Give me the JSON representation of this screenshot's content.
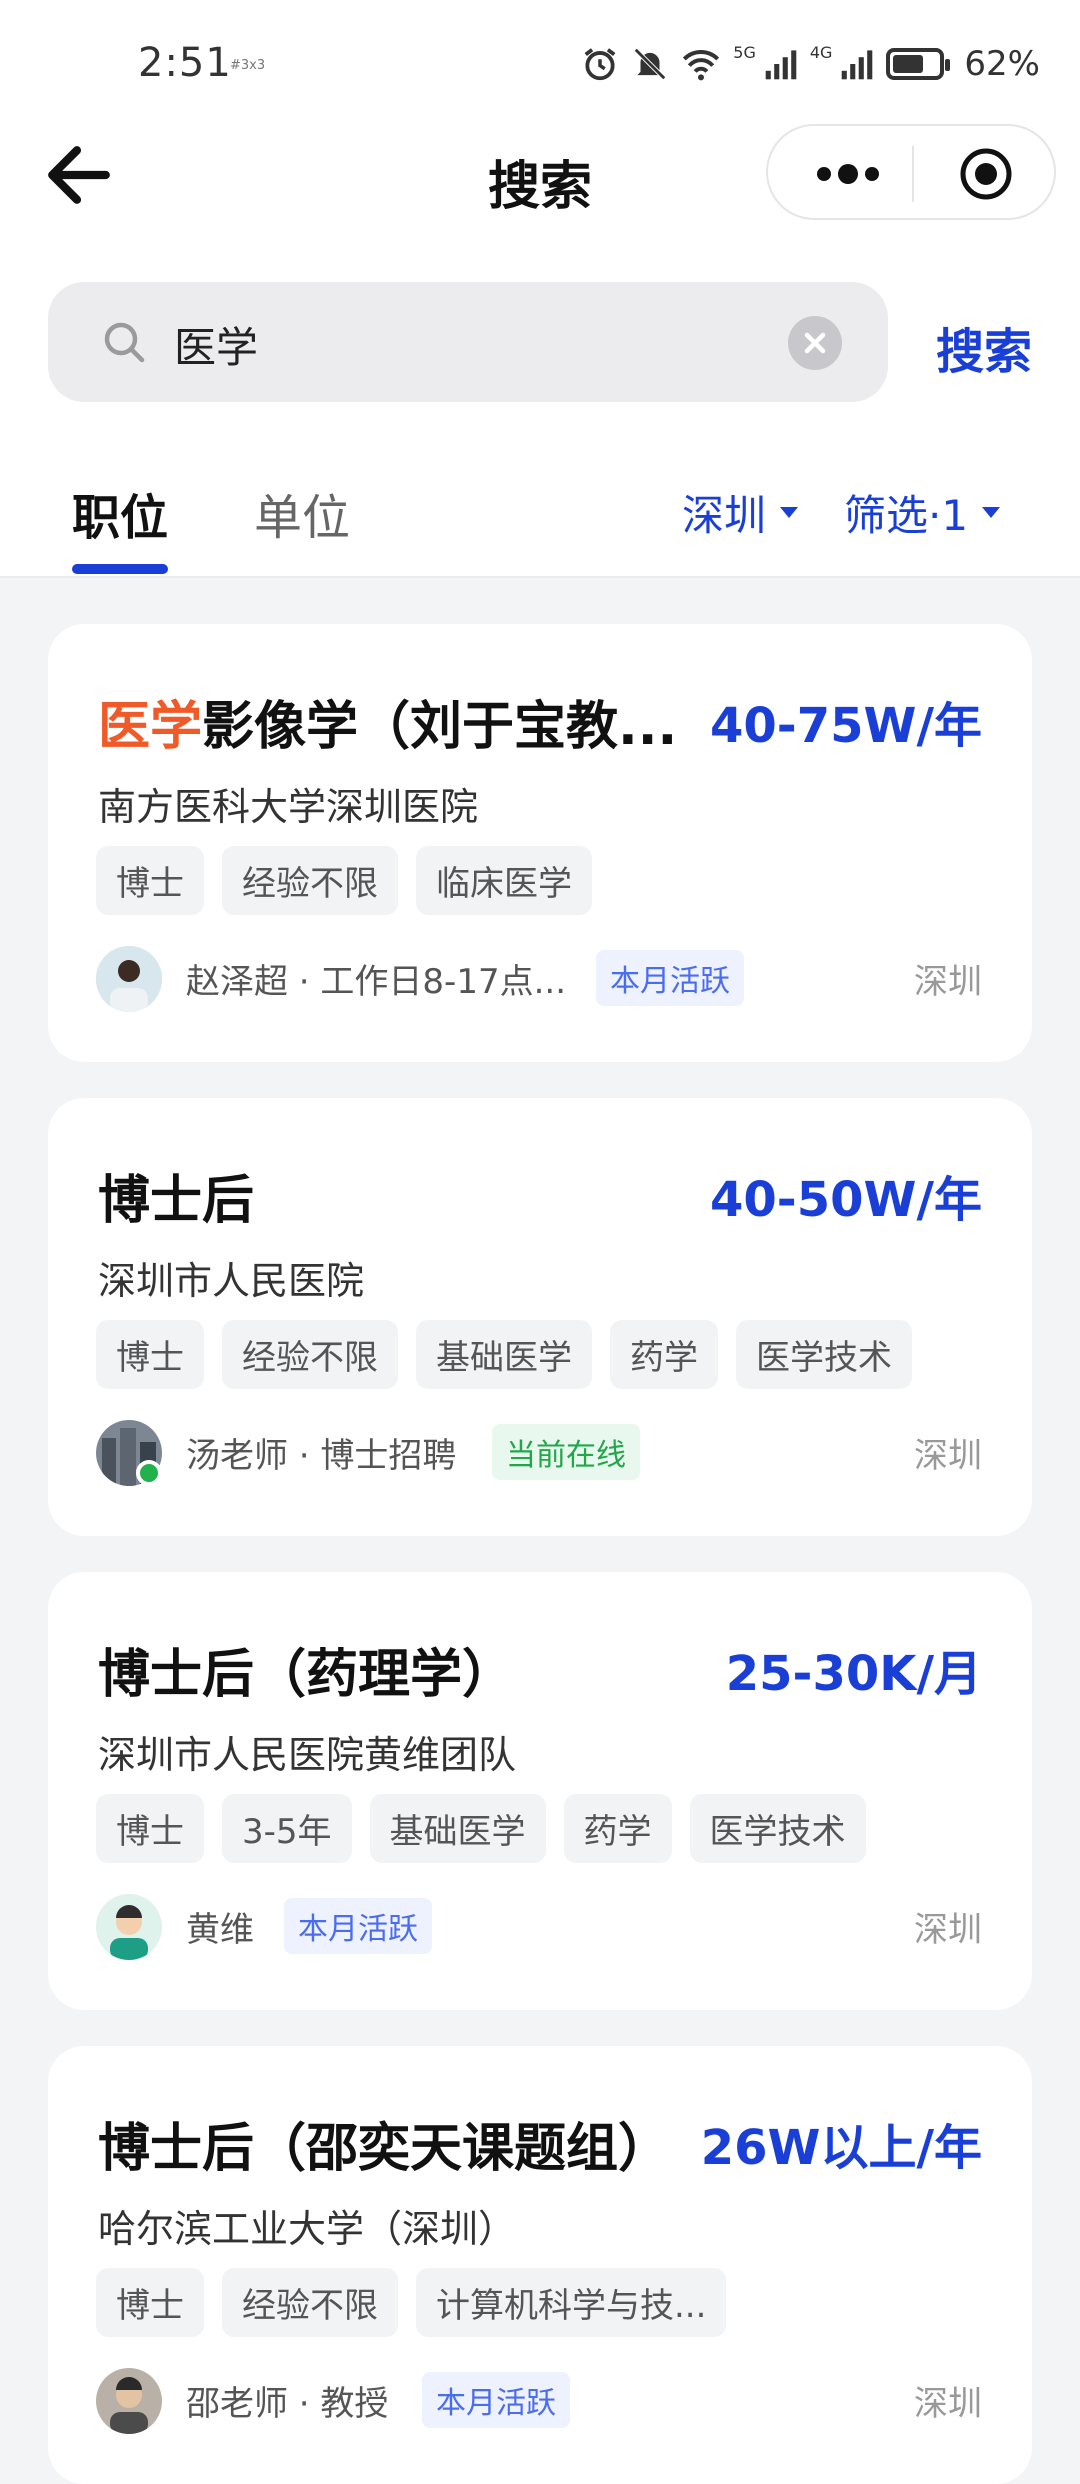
{
  "status_bar": {
    "time": "2:51",
    "carrier_note": "#3x3",
    "net_5g": "5G",
    "net_4g": "4G",
    "battery": "62%",
    "icons": [
      "alarm-icon",
      "mute-icon",
      "wifi-icon",
      "signal-icon",
      "battery-icon"
    ]
  },
  "nav": {
    "title": "搜索"
  },
  "search": {
    "value": "医学",
    "button_label": "搜索"
  },
  "tabs": [
    {
      "label": "职位",
      "active": true
    },
    {
      "label": "单位",
      "active": false
    }
  ],
  "filters": {
    "city": "深圳",
    "filter": "筛选·1"
  },
  "jobs": [
    {
      "title_highlight": "医学",
      "title_rest": "影像学（刘于宝教...",
      "salary": "40-75W/年",
      "org": "南方医科大学深圳医院",
      "tags": [
        "博士",
        "经验不限",
        "临床医学"
      ],
      "recruiter": "赵泽超 · 工作日8-17点...",
      "badge": "本月活跃",
      "badge_type": "blue",
      "location": "深圳"
    },
    {
      "title_highlight": "",
      "title_rest": "博士后",
      "salary": "40-50W/年",
      "org": "深圳市人民医院",
      "tags": [
        "博士",
        "经验不限",
        "基础医学",
        "药学",
        "医学技术"
      ],
      "recruiter": "汤老师 · 博士招聘",
      "badge": "当前在线",
      "badge_type": "green",
      "location": "深圳"
    },
    {
      "title_highlight": "",
      "title_rest": "博士后（药理学）",
      "salary": "25-30K/月",
      "org": "深圳市人民医院黄维团队",
      "tags": [
        "博士",
        "3-5年",
        "基础医学",
        "药学",
        "医学技术"
      ],
      "recruiter": "黄维",
      "badge": "本月活跃",
      "badge_type": "blue",
      "location": "深圳"
    },
    {
      "title_highlight": "",
      "title_rest": "博士后（邵奕天课题组）",
      "salary": "26W以上/年",
      "org": "哈尔滨工业大学（深圳）",
      "tags": [
        "博士",
        "经验不限",
        "计算机科学与技..."
      ],
      "recruiter": "邵老师 · 教授",
      "badge": "本月活跃",
      "badge_type": "blue",
      "location": "深圳"
    }
  ],
  "colors": {
    "accent": "#1a3fd6",
    "highlight": "#f05a28",
    "online": "#22b14c"
  }
}
